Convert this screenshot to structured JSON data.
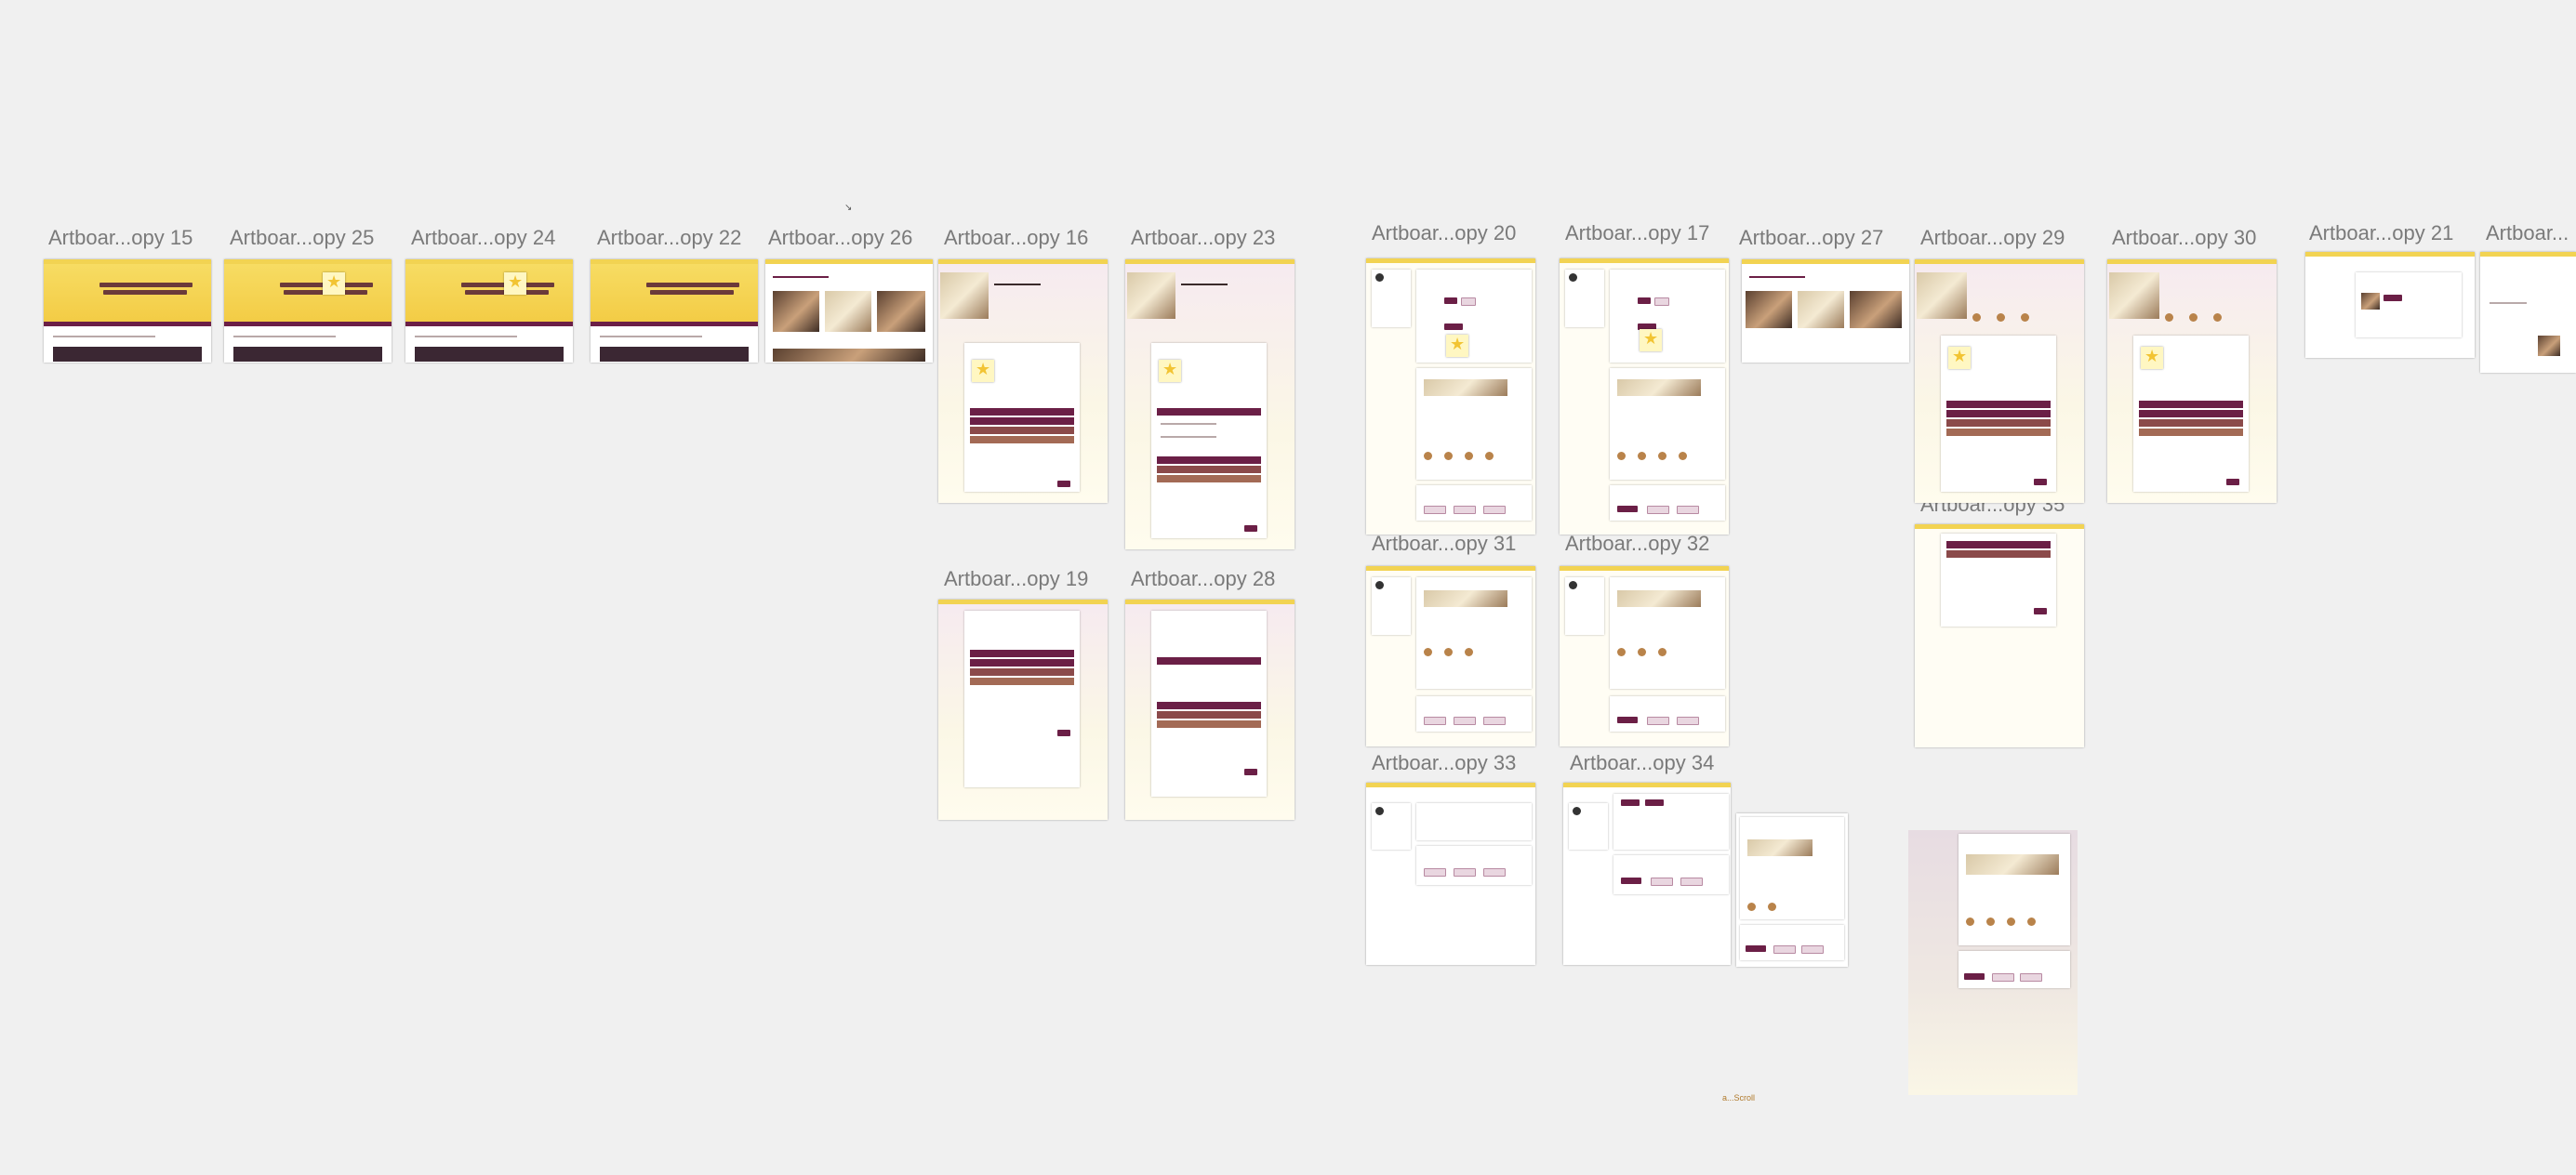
{
  "canvas": {
    "background": "#f0f0f0",
    "accent_yellow": "#f2d352",
    "accent_maroon": "#6b1f46"
  },
  "artboards": [
    {
      "id": "a15",
      "label": "Artboar...opy 15"
    },
    {
      "id": "a25",
      "label": "Artboar...opy 25"
    },
    {
      "id": "a24",
      "label": "Artboar...opy 24"
    },
    {
      "id": "a22",
      "label": "Artboar...opy 22"
    },
    {
      "id": "a26",
      "label": "Artboar...opy 26"
    },
    {
      "id": "a16",
      "label": "Artboar...opy 16"
    },
    {
      "id": "a23",
      "label": "Artboar...opy 23"
    },
    {
      "id": "a20",
      "label": "Artboar...opy 20"
    },
    {
      "id": "a17",
      "label": "Artboar...opy 17"
    },
    {
      "id": "a27",
      "label": "Artboar...opy 27"
    },
    {
      "id": "a29",
      "label": "Artboar...opy 29"
    },
    {
      "id": "a30",
      "label": "Artboar...opy 30"
    },
    {
      "id": "a21",
      "label": "Artboar...opy 21"
    },
    {
      "id": "aR",
      "label": "Artboar..."
    },
    {
      "id": "a35",
      "label": "Artboar...opy 35"
    },
    {
      "id": "a19",
      "label": "Artboar...opy 19"
    },
    {
      "id": "a28",
      "label": "Artboar...opy 28"
    },
    {
      "id": "a31",
      "label": "Artboar...opy 31"
    },
    {
      "id": "a32",
      "label": "Artboar...opy 32"
    },
    {
      "id": "a33",
      "label": "Artboar...opy 33"
    },
    {
      "id": "a34",
      "label": "Artboar...opy 34"
    }
  ],
  "footer_tag": "a...Scroll",
  "icons": {
    "star": "star-icon",
    "cursor": "pointer-cursor-icon"
  }
}
